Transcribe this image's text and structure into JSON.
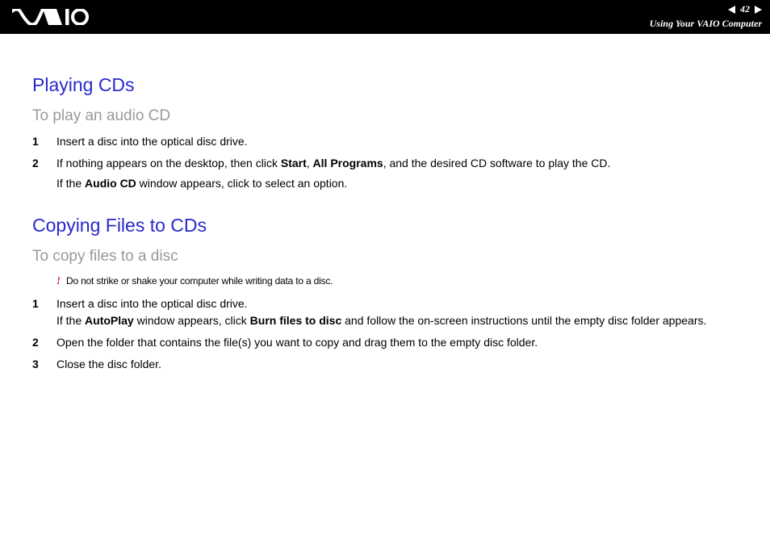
{
  "header": {
    "page_number": "42",
    "section": "Using Your VAIO Computer"
  },
  "section1": {
    "heading": "Playing CDs",
    "subheading": "To play an audio CD",
    "steps": [
      {
        "num": "1",
        "text": "Insert a disc into the optical disc drive."
      },
      {
        "num": "2",
        "pre": "If nothing appears on the desktop, then click ",
        "b1": "Start",
        "mid1": ", ",
        "b2": "All Programs",
        "post1": ", and the desired CD software to play the CD.",
        "sub_pre": "If the ",
        "sub_b": "Audio CD",
        "sub_post": " window appears, click to select an option."
      }
    ]
  },
  "section2": {
    "heading": "Copying Files to CDs",
    "subheading": "To copy files to a disc",
    "warning_mark": "!",
    "warning": "Do not strike or shake your computer while writing data to a disc.",
    "steps": [
      {
        "num": "1",
        "line1": "Insert a disc into the optical disc drive.",
        "l2_pre": "If the ",
        "l2_b1": "AutoPlay",
        "l2_mid": " window appears, click ",
        "l2_b2": "Burn files to disc",
        "l2_post": " and follow the on-screen instructions until the empty disc folder appears."
      },
      {
        "num": "2",
        "text": "Open the folder that contains the file(s) you want to copy and drag them to the empty disc folder."
      },
      {
        "num": "3",
        "text": "Close the disc folder."
      }
    ]
  }
}
